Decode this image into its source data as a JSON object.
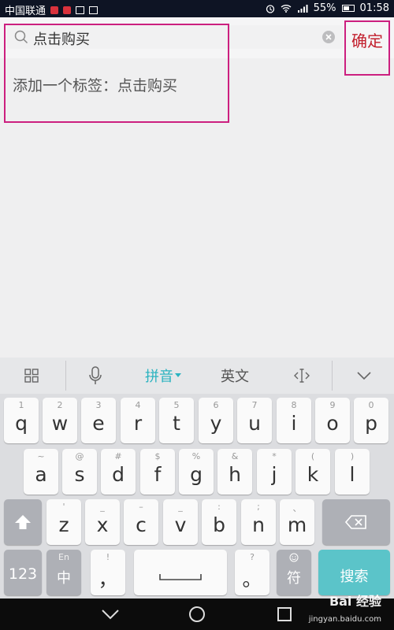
{
  "status_bar": {
    "carrier": "中国联通",
    "battery_percent": "55%",
    "time": "01:58"
  },
  "search": {
    "text": "点击购买",
    "confirm_label": "确定"
  },
  "suggestion": {
    "text": "添加一个标签：点击购买"
  },
  "keyboard": {
    "toolbar": {
      "pinyin_label": "拼音",
      "english_label": "英文"
    },
    "row1": [
      {
        "sub": "1",
        "main": "q"
      },
      {
        "sub": "2",
        "main": "w"
      },
      {
        "sub": "3",
        "main": "e"
      },
      {
        "sub": "4",
        "main": "r"
      },
      {
        "sub": "5",
        "main": "t"
      },
      {
        "sub": "6",
        "main": "y"
      },
      {
        "sub": "7",
        "main": "u"
      },
      {
        "sub": "8",
        "main": "i"
      },
      {
        "sub": "9",
        "main": "o"
      },
      {
        "sub": "0",
        "main": "p"
      }
    ],
    "row2": [
      {
        "sub": "~",
        "main": "a"
      },
      {
        "sub": "@",
        "main": "s"
      },
      {
        "sub": "#",
        "main": "d"
      },
      {
        "sub": "$",
        "main": "f"
      },
      {
        "sub": "%",
        "main": "g"
      },
      {
        "sub": "&",
        "main": "h"
      },
      {
        "sub": "*",
        "main": "j"
      },
      {
        "sub": "(",
        "main": "k"
      },
      {
        "sub": ")",
        "main": "l"
      }
    ],
    "row3": [
      {
        "sub": "'",
        "main": "z"
      },
      {
        "sub": "_",
        "main": "x"
      },
      {
        "sub": "–",
        "main": "c"
      },
      {
        "sub": "_",
        "main": "v"
      },
      {
        "sub": ":",
        "main": "b"
      },
      {
        "sub": ";",
        "main": "n"
      },
      {
        "sub": "、",
        "main": "m"
      }
    ],
    "num_label": "123",
    "lang_sub": "En",
    "lang_main": "中",
    "comma_sub": "!",
    "comma_main": "，",
    "period_sub": "?",
    "period_main": "。",
    "symbol_main": "符",
    "search_label": "搜索"
  },
  "watermark": {
    "text": "Bai 经验",
    "sub": "jingyan.baidu.com"
  },
  "colors": {
    "confirm": "#c21e2c",
    "highlight_border": "#cc1f7f",
    "pinyin_accent": "#2bb3c0",
    "search_key": "#5bc4c9"
  }
}
